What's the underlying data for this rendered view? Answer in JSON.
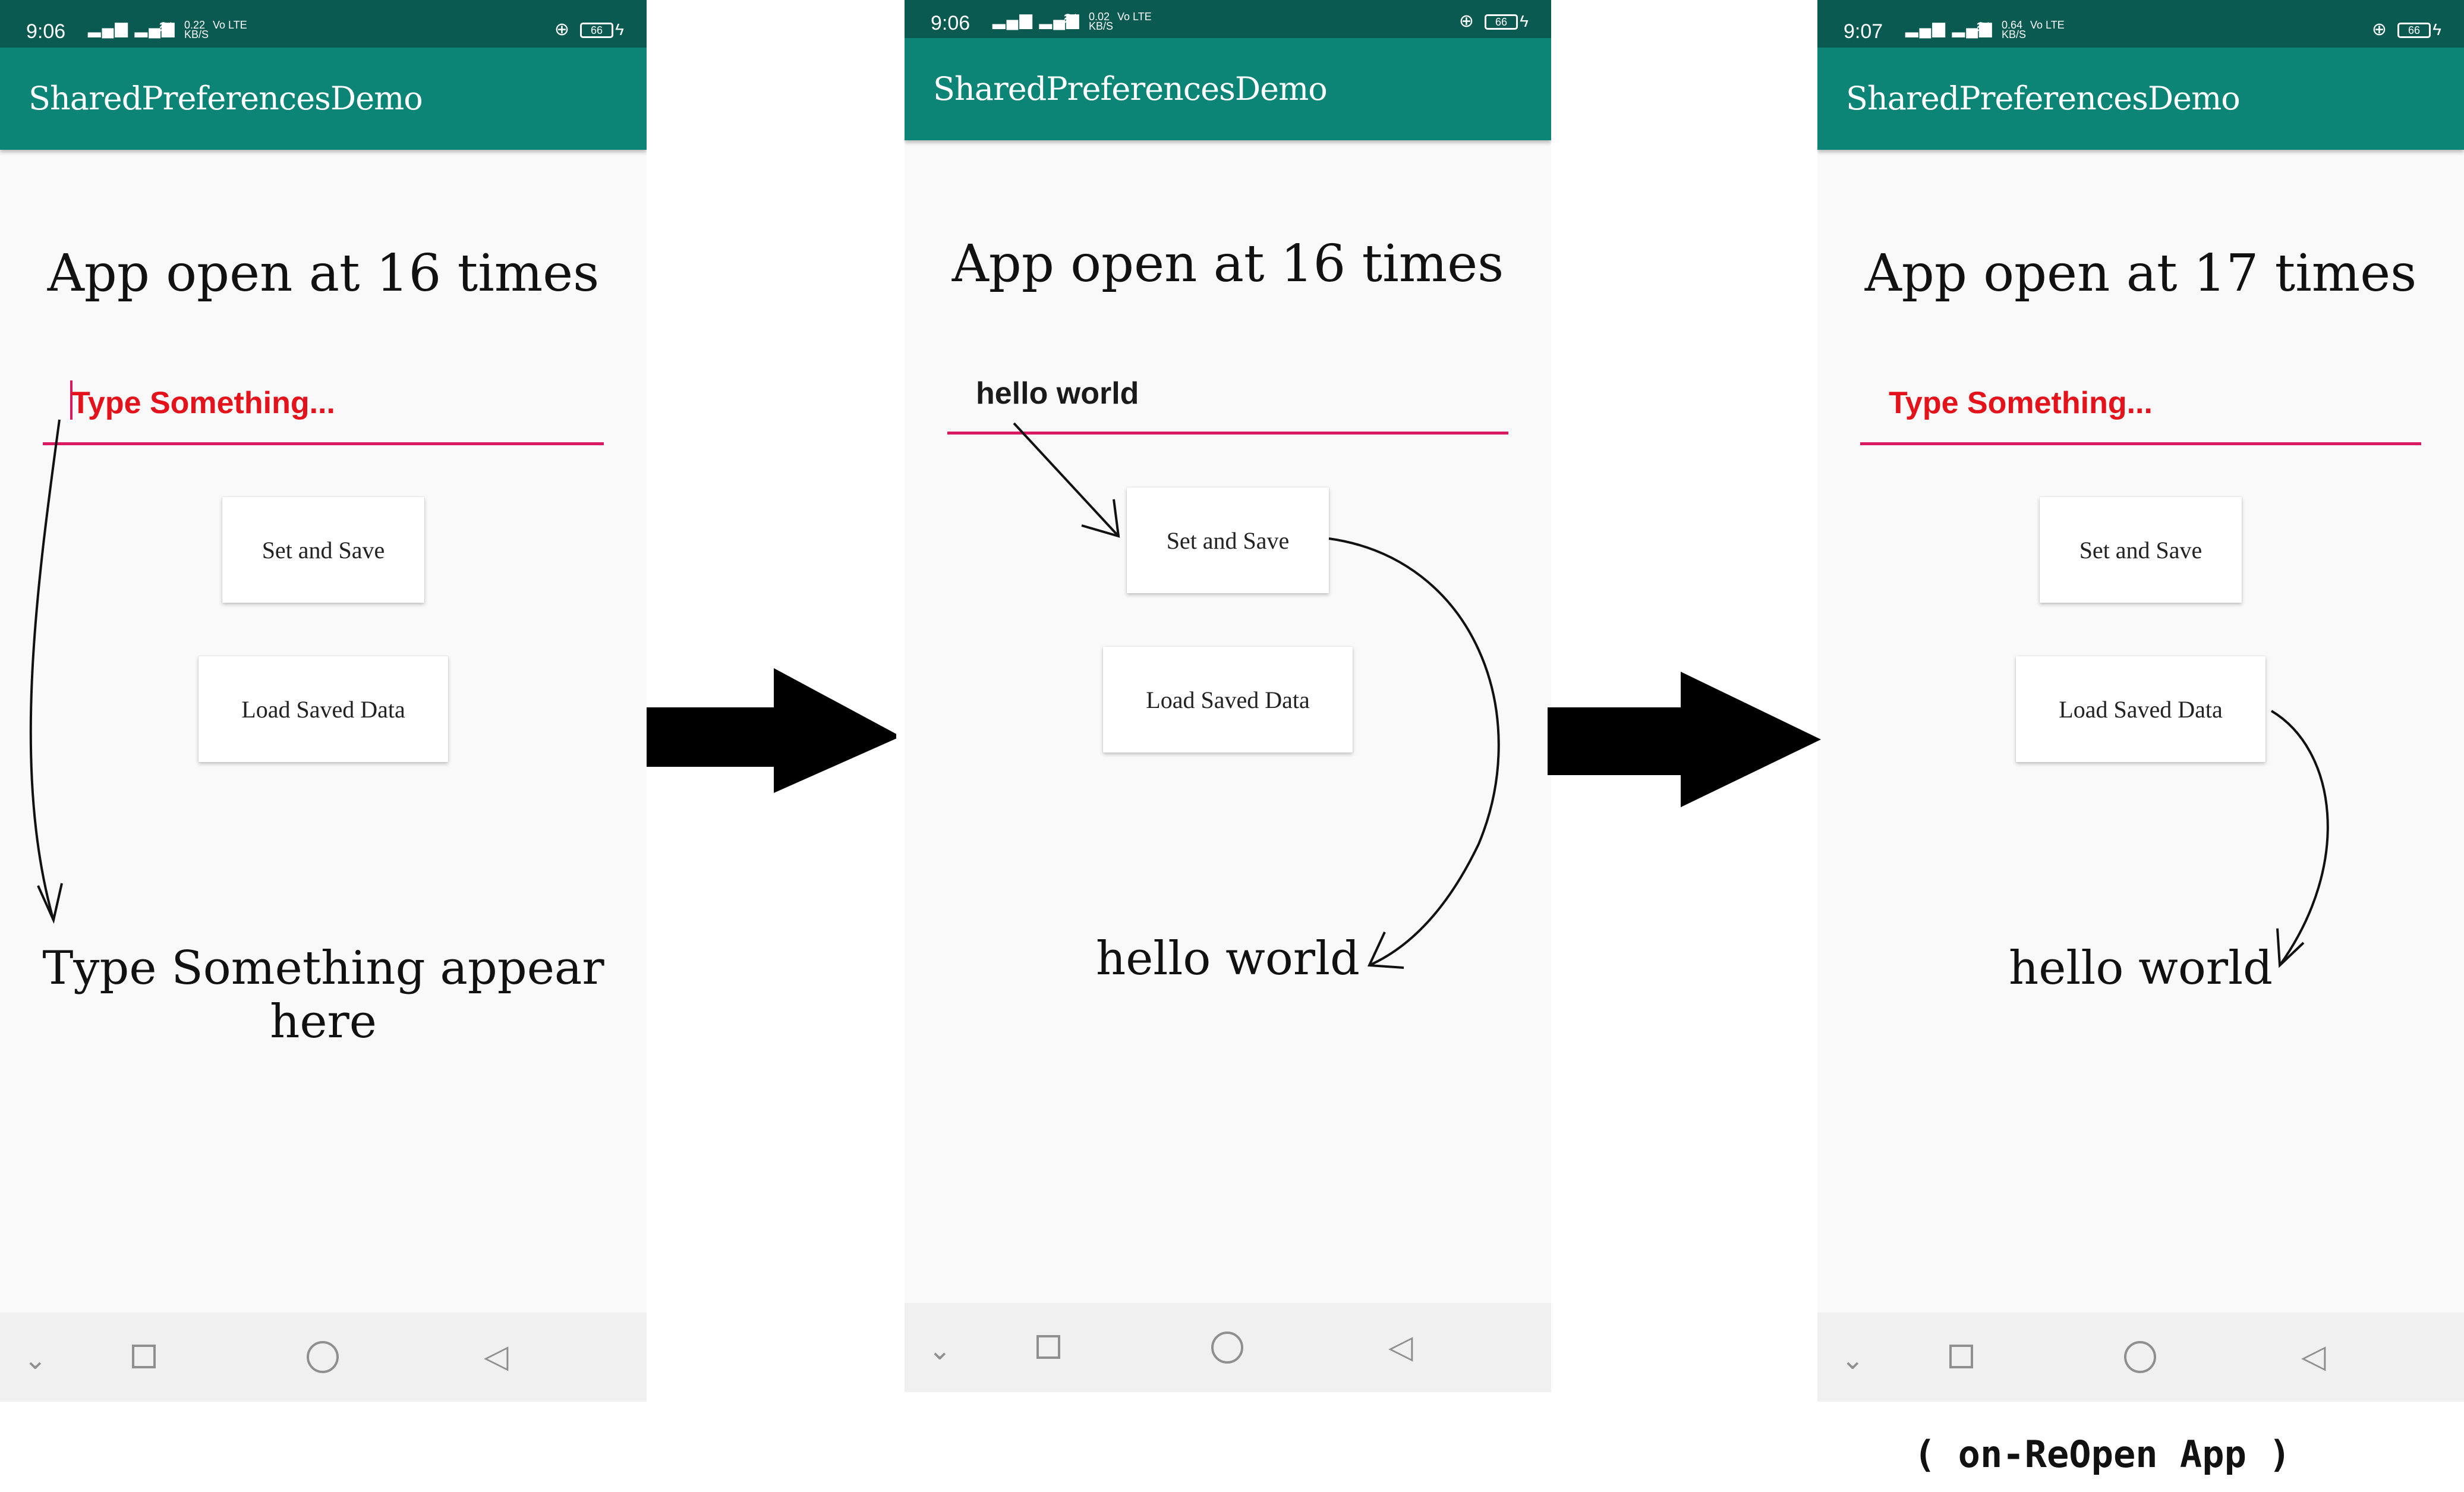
{
  "screens": [
    {
      "status_time": "9:06",
      "status_speed": "0.22 KB/S",
      "status_network": "Vo LTE",
      "battery": "66",
      "app_title": "SharedPreferencesDemo",
      "headline": "App open at 16 times",
      "input": {
        "value": "",
        "placeholder": "Type Something...",
        "focused": true
      },
      "buttons": {
        "save": "Set and Save",
        "load": "Load Saved Data"
      },
      "result_text": "Type Something appear here"
    },
    {
      "status_time": "9:06",
      "status_speed": "0.02 KB/S",
      "status_network": "Vo LTE",
      "battery": "66",
      "app_title": "SharedPreferencesDemo",
      "headline": "App open at 16 times",
      "input": {
        "value": "hello world",
        "placeholder": "Type Something...",
        "focused": false
      },
      "buttons": {
        "save": "Set and Save",
        "load": "Load Saved Data"
      },
      "result_text": "hello world"
    },
    {
      "status_time": "9:07",
      "status_speed": "0.64 KB/S",
      "status_network": "Vo LTE",
      "battery": "66",
      "app_title": "SharedPreferencesDemo",
      "headline": "App open at 17 times",
      "input": {
        "value": "",
        "placeholder": "Type Something...",
        "focused": false
      },
      "buttons": {
        "save": "Set and Save",
        "load": "Load Saved Data"
      },
      "result_text": "hello world"
    }
  ],
  "caption": "( on-ReOpen App )",
  "colors": {
    "status_bar": "#0b5a51",
    "app_bar": "#0c8576",
    "underline": "#d81b60",
    "placeholder": "#e3121b",
    "background": "#f9f9f9"
  },
  "icons": [
    "signal-icon",
    "wifi-icon",
    "lock-icon",
    "battery-icon",
    "nav-down-icon",
    "nav-recents-icon",
    "nav-home-icon",
    "nav-back-icon",
    "flow-arrow-icon"
  ]
}
